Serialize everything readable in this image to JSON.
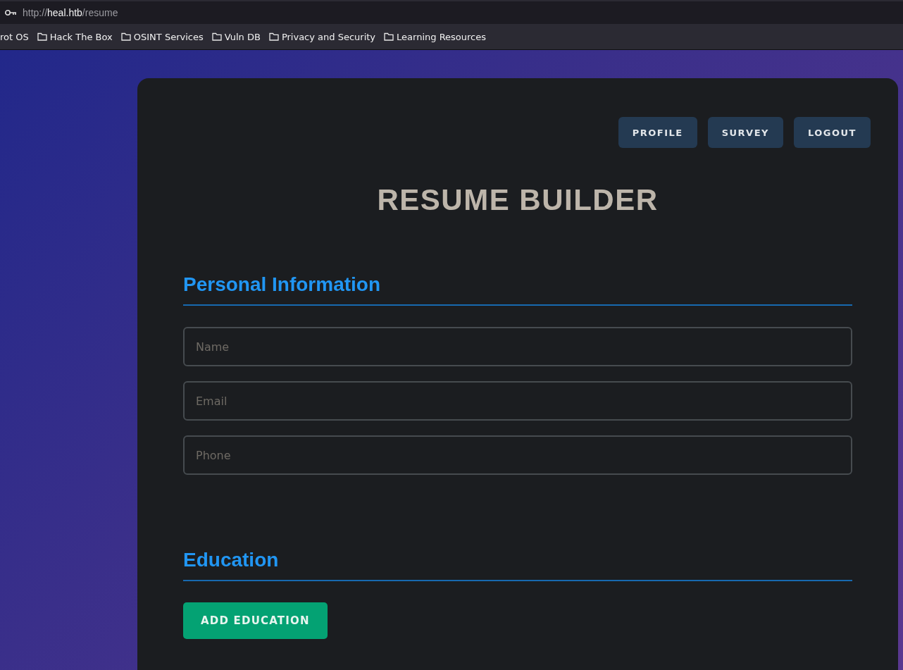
{
  "browser": {
    "url": {
      "scheme": "http://",
      "host": "heal.htb",
      "path": "/resume"
    },
    "bookmarks": [
      {
        "label": "rot OS",
        "folder": false
      },
      {
        "label": "Hack The Box",
        "folder": true
      },
      {
        "label": "OSINT Services",
        "folder": true
      },
      {
        "label": "Vuln DB",
        "folder": true
      },
      {
        "label": "Privacy and Security",
        "folder": true
      },
      {
        "label": "Learning Resources",
        "folder": true
      }
    ]
  },
  "nav": [
    "PROFILE",
    "SURVEY",
    "LOGOUT"
  ],
  "title": "RESUME BUILDER",
  "sections": [
    {
      "heading": "Personal Information",
      "fields": [
        {
          "placeholder": "Name"
        },
        {
          "placeholder": "Email"
        },
        {
          "placeholder": "Phone"
        }
      ]
    },
    {
      "heading": "Education",
      "button": "ADD EDUCATION"
    }
  ]
}
